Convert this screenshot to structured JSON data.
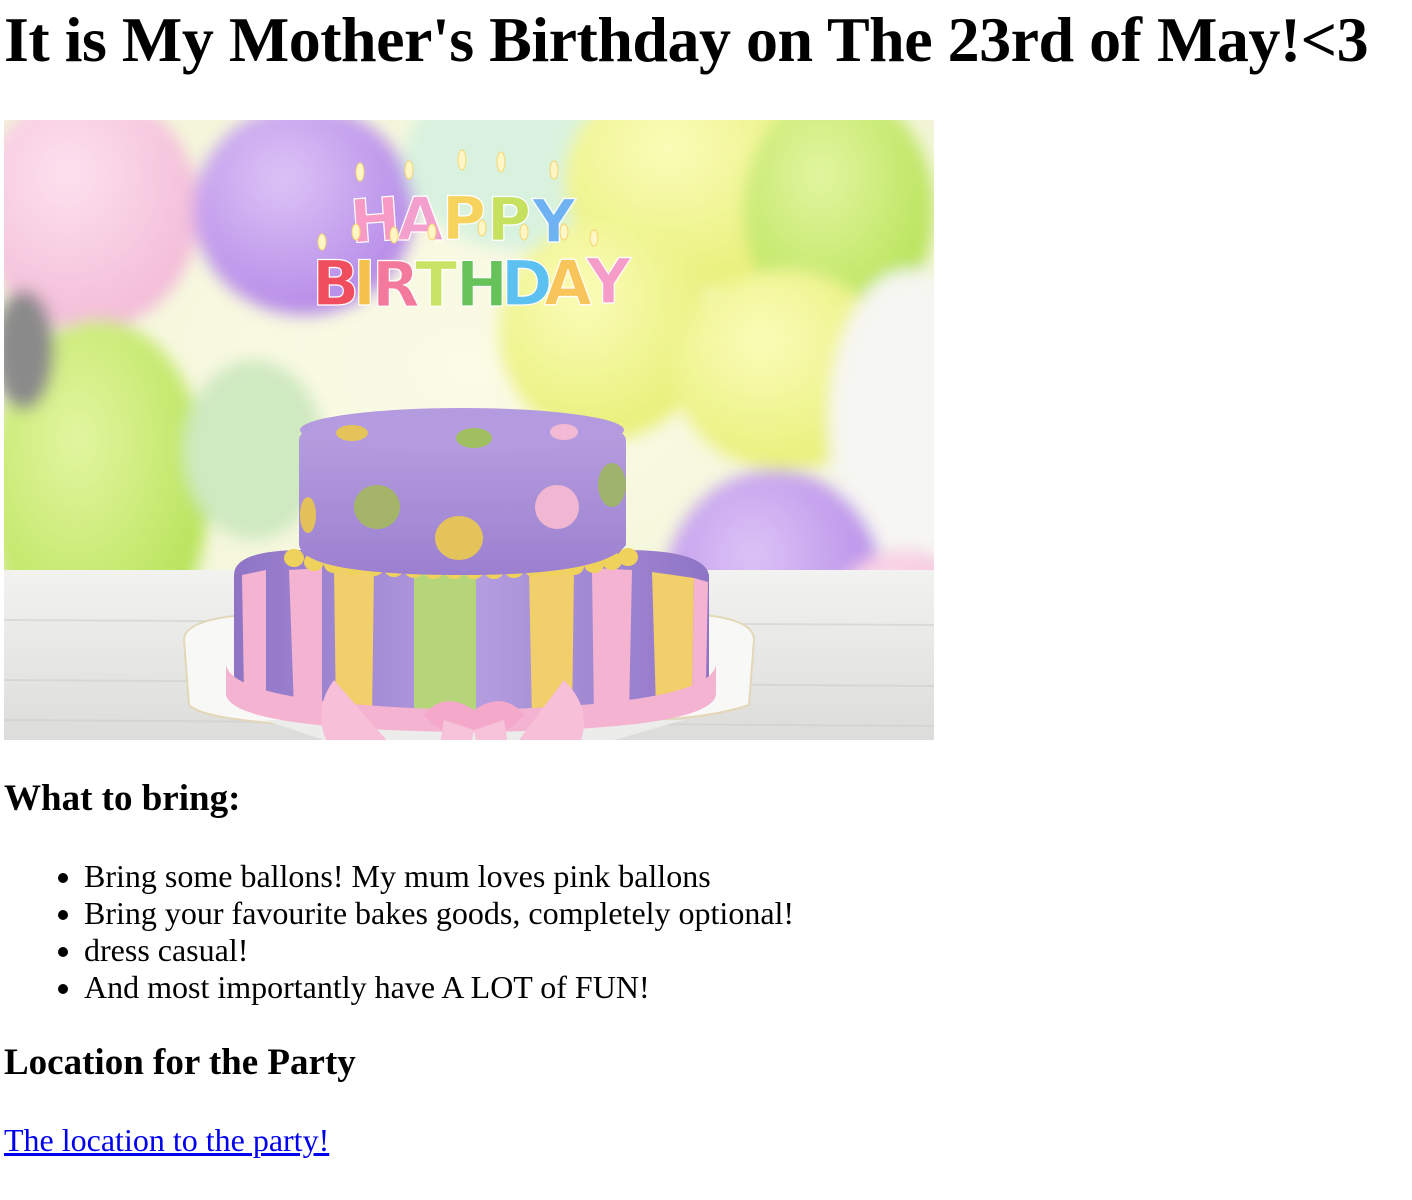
{
  "page": {
    "title": "It is My Mother's Birthday on The 23rd of May!<3"
  },
  "hero_image": {
    "candle_top": "HAPPY",
    "candle_bottom": "BIRTHDAY"
  },
  "bring": {
    "heading": "What to bring:",
    "items": [
      "Bring some ballons! My mum loves pink ballons",
      "Bring your favourite bakes goods, completely optional!",
      "dress casual!",
      "And most importantly have A LOT of FUN!"
    ]
  },
  "location": {
    "heading": "Location for the Party",
    "link_text": "The location to the party!"
  },
  "colors": {
    "link": "#0000ee",
    "cake_purple": "#a98fd6",
    "cake_pink": "#f4b3d0",
    "cake_yellow": "#f1cf6a",
    "cake_green": "#b6d57a"
  }
}
